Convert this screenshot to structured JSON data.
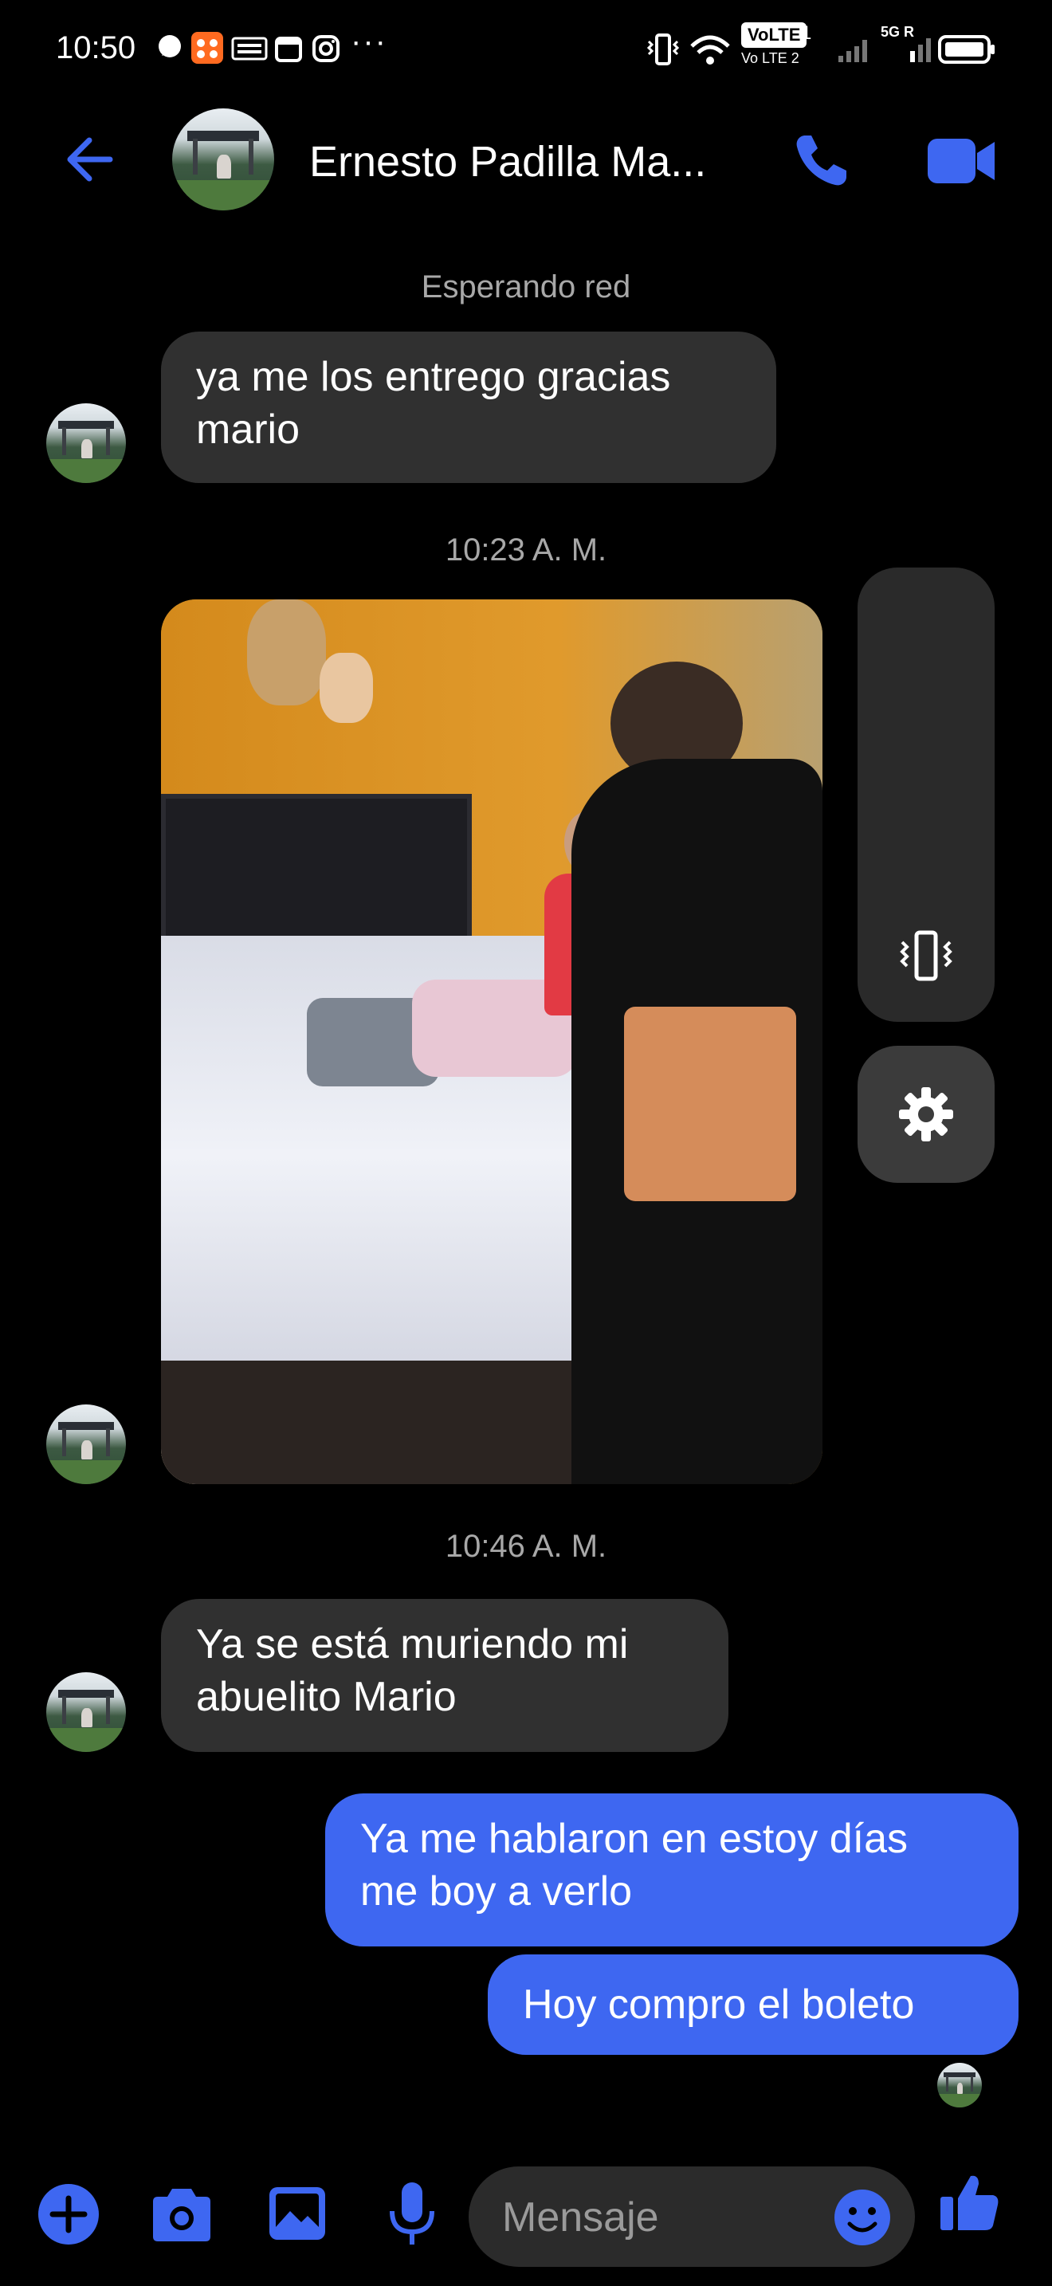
{
  "status_bar": {
    "time": "10:50",
    "more": "···",
    "volte": "VoLTE",
    "volte_sub": "Vo LTE 2",
    "sim1": "1",
    "net": "5G R"
  },
  "header": {
    "contact_name": "Ernesto Padilla Ma...",
    "icons": [
      "back-arrow-icon",
      "phone-icon",
      "video-camera-icon"
    ],
    "accent_color": "#3e67f1"
  },
  "conversation": {
    "waiting_network": "Esperando red",
    "messages": [
      {
        "from": "contact",
        "text": "ya me los entrego gracias\nmario"
      },
      {
        "type": "timestamp",
        "text": "10:23 A. M."
      },
      {
        "from": "contact",
        "type": "photo"
      },
      {
        "type": "timestamp",
        "text": "10:46 A. M."
      },
      {
        "from": "contact",
        "text": "Ya se está muriendo mi\nabuelito Mario"
      },
      {
        "from": "me",
        "text": "Ya me hablaron en estoy días\nme boy a verlo"
      },
      {
        "from": "me",
        "text": "Hoy compro el boleto"
      }
    ],
    "timestamp_1": "10:23 A. M.",
    "timestamp_2": "10:46 A. M.",
    "msg_1": "ya me los entrego gracias\nmario",
    "msg_2": "Ya se está muriendo mi\nabuelito Mario",
    "msg_3": "Ya me hablaron en estoy días\nme boy a verlo",
    "msg_4": "Hoy compro el boleto"
  },
  "composer": {
    "placeholder": "Mensaje",
    "icons": [
      "plus-icon",
      "camera-icon",
      "gallery-icon",
      "microphone-icon",
      "emoji-icon",
      "thumbs-up-icon"
    ]
  },
  "floating_panel": {
    "icons": [
      "vibrate-icon",
      "settings-gear-icon"
    ]
  }
}
